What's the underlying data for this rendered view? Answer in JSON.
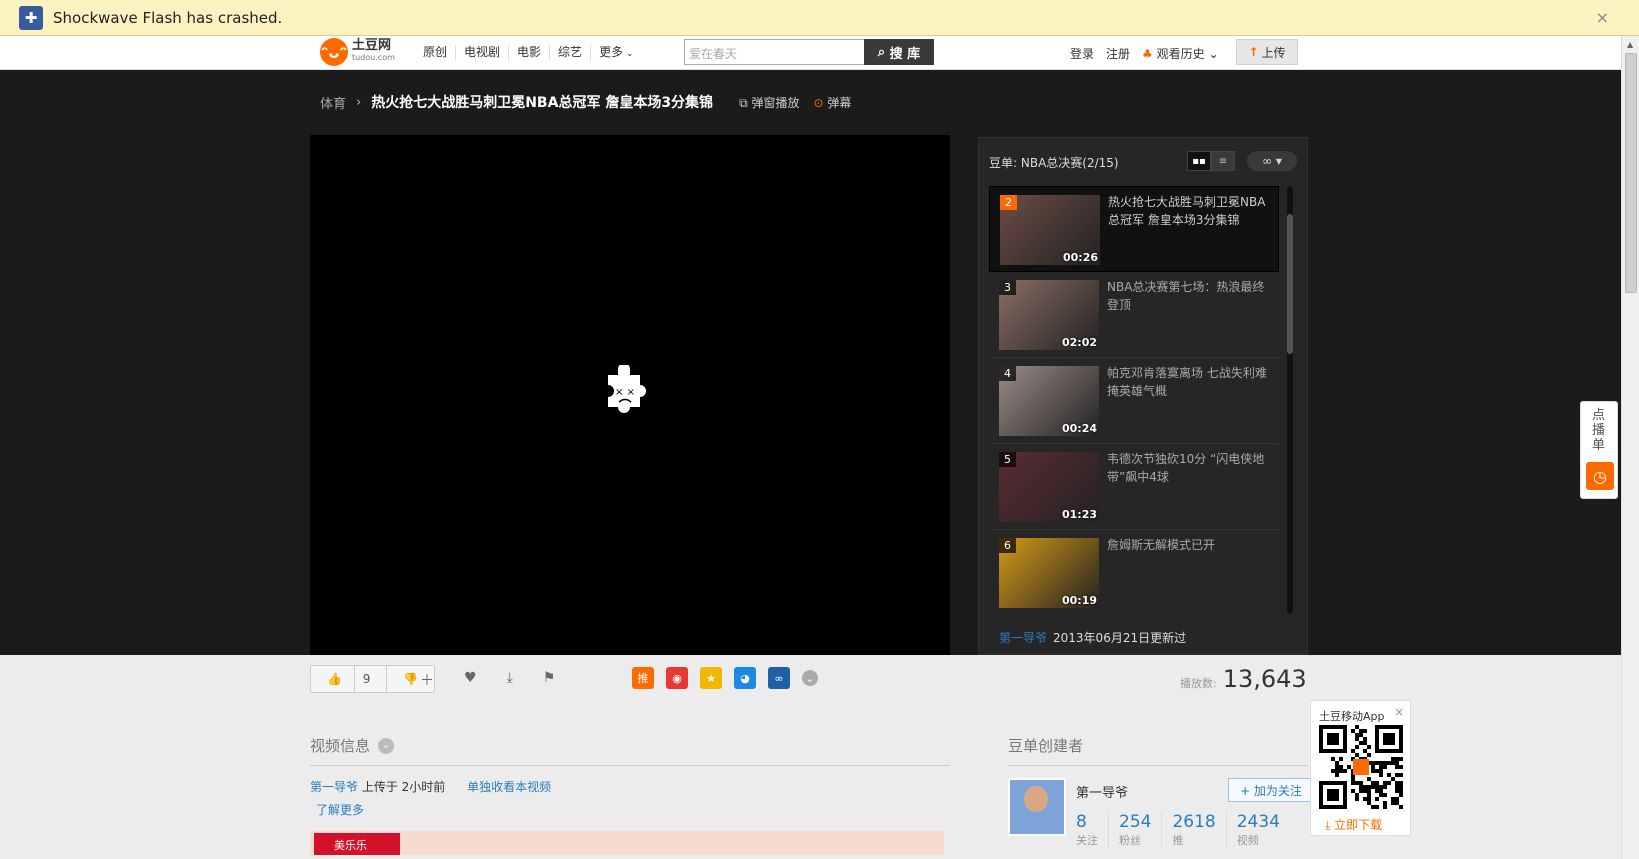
{
  "crashbar": {
    "message": "Shockwave Flash has crashed.",
    "close": "×"
  },
  "header": {
    "logo_cn": "土豆网",
    "logo_en": "tudou.com",
    "nav": [
      "原创",
      "电视剧",
      "电影",
      "综艺",
      "更多"
    ],
    "search_placeholder": "爱在春天",
    "search_button": "搜 库",
    "login": "登录",
    "register": "注册",
    "history": "观看历史",
    "upload": "上传"
  },
  "breadcrumb": {
    "category": "体育",
    "title": "热火抢七大战胜马刺卫冕NBA总冠军 詹皇本场3分集锦",
    "popup_play": "弹窗播放",
    "danmu": "弹幕"
  },
  "playlist": {
    "header": "豆单: NBA总决赛(2/15)",
    "items": [
      {
        "num": "2",
        "duration": "00:26",
        "title": "热火抢七大战胜马刺卫冕NBA总冠军 詹皇本场3分集锦",
        "active": true,
        "color": "#6c4d45"
      },
      {
        "num": "3",
        "duration": "02:02",
        "title": "NBA总决赛第七场：热浪最终登顶",
        "active": false,
        "color": "#8a6e63"
      },
      {
        "num": "4",
        "duration": "00:24",
        "title": "帕克邓肯落寞离场 七战失利难掩英雄气概",
        "active": false,
        "color": "#9b8c88"
      },
      {
        "num": "5",
        "duration": "01:23",
        "title": "韦德次节独砍10分 “闪电侠地带”飙中4球",
        "active": false,
        "color": "#5a2c33"
      },
      {
        "num": "6",
        "duration": "00:19",
        "title": "詹姆斯无解模式已开",
        "active": false,
        "color": "#d69a16"
      }
    ],
    "footer_author": "第一导爷",
    "footer_date": "2013年06月21日更新过"
  },
  "actions": {
    "like_count": "9",
    "share_colors": [
      "#ff6a00",
      "#e53935",
      "#f2b600",
      "#1e88e5",
      "#1e5fa8"
    ],
    "share_first_label": "推",
    "playcount_label": "播放数:",
    "playcount": "13,643"
  },
  "info": {
    "section_title": "视频信息",
    "author": "第一导爷",
    "uploaded": " 上传于 2小时前",
    "collect": "单独收看本视频",
    "more": "了解更多",
    "ad_text": "美乐乐"
  },
  "creator": {
    "section_title": "豆单创建者",
    "name": "第一导爷",
    "follow": "+ 加为关注",
    "stats": [
      {
        "value": "8",
        "label": "关注"
      },
      {
        "value": "254",
        "label": "粉丝"
      },
      {
        "value": "2618",
        "label": "推"
      },
      {
        "value": "2434",
        "label": "视频"
      }
    ]
  },
  "qr": {
    "title": "土豆移动App",
    "close": "×",
    "download": "立即下载"
  },
  "sidetab": {
    "text": "点播单"
  }
}
